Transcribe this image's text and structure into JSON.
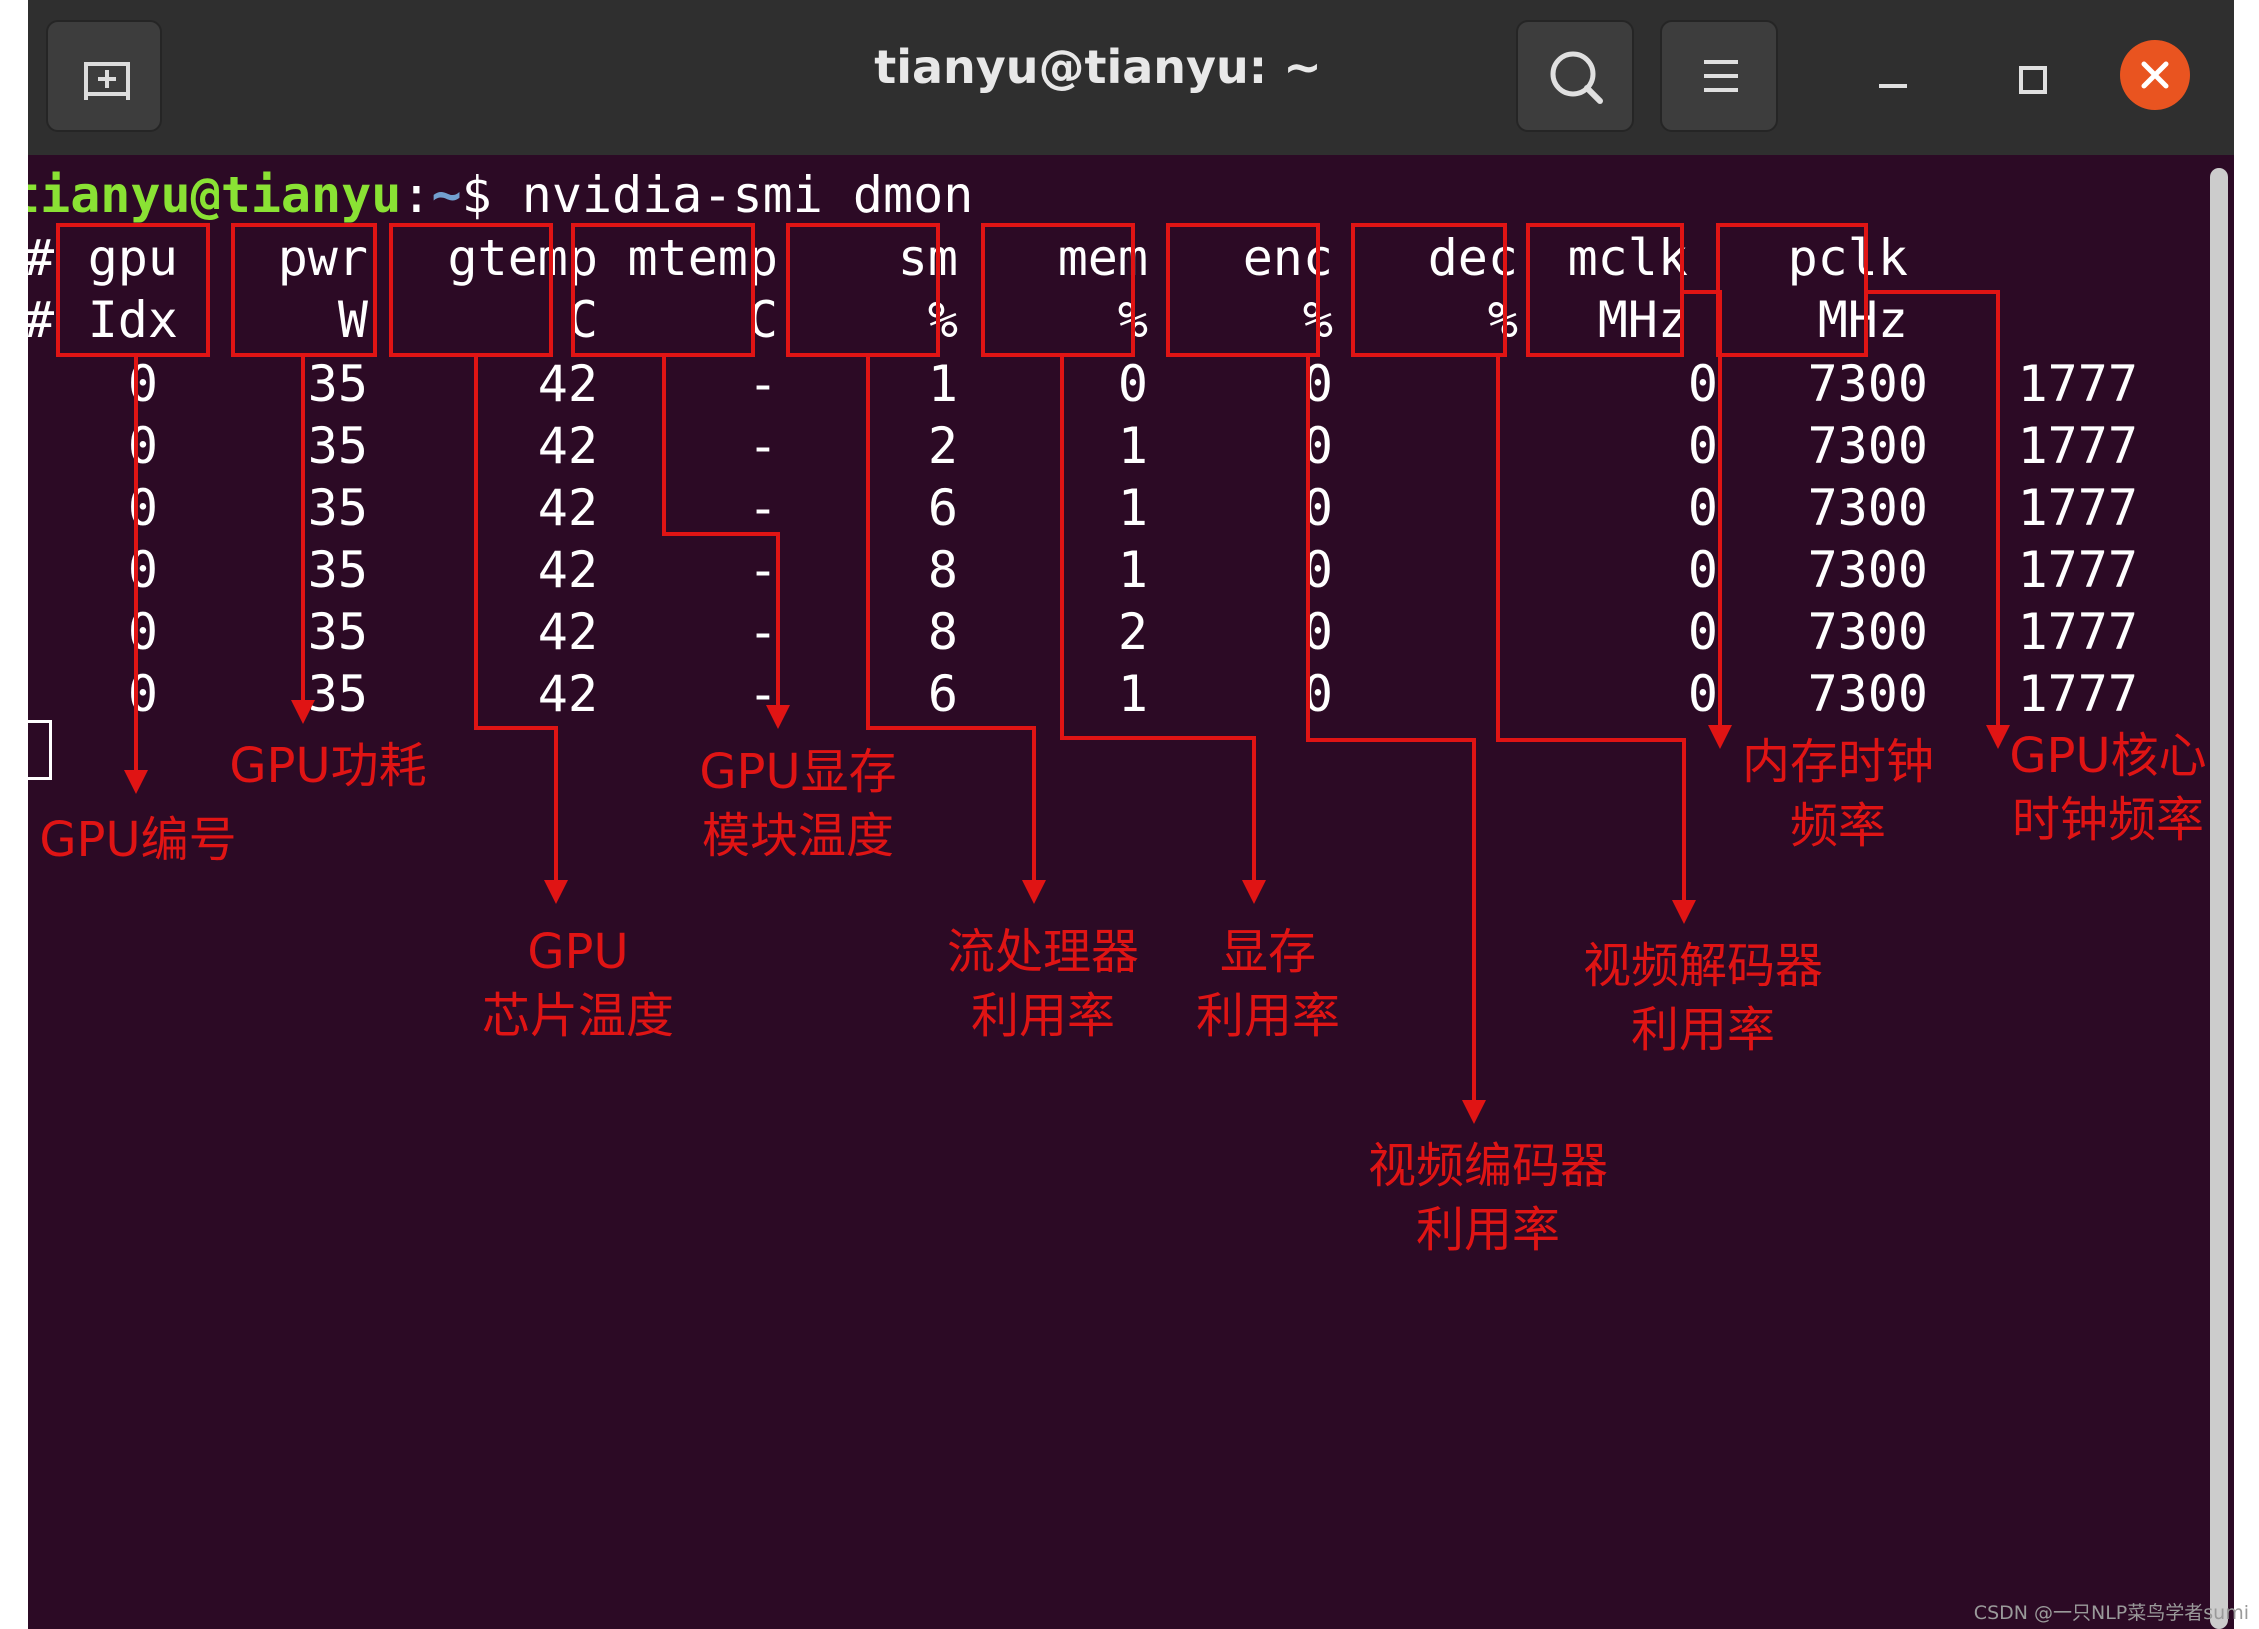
{
  "window": {
    "title": "tianyu@tianyu: ~"
  },
  "titlebar": {
    "new_tab_icon": "new-tab-icon",
    "search_icon": "search-icon",
    "menu_icon": "hamburger-menu-icon",
    "minimize_icon": "minimize-icon",
    "maximize_icon": "maximize-icon",
    "close_icon": "close-icon"
  },
  "terminal": {
    "prompt_user": "tianyu@tianyu",
    "prompt_sep": ":",
    "prompt_path": "~",
    "prompt_symbol": "$ ",
    "command": "nvidia-smi dmon",
    "hash": "#",
    "columns": [
      {
        "name": "gpu",
        "unit": "Idx"
      },
      {
        "name": "pwr",
        "unit": "W"
      },
      {
        "name": "gtemp",
        "unit": "C"
      },
      {
        "name": "mtemp",
        "unit": "C"
      },
      {
        "name": "sm",
        "unit": "%"
      },
      {
        "name": "mem",
        "unit": "%"
      },
      {
        "name": "enc",
        "unit": "%"
      },
      {
        "name": "dec",
        "unit": "%"
      },
      {
        "name": "mclk",
        "unit": "MHz"
      },
      {
        "name": "pclk",
        "unit": "MHz"
      }
    ],
    "rows": [
      [
        "0",
        "35",
        "42",
        "-",
        "1",
        "0",
        "0",
        "0",
        "7300",
        "1777"
      ],
      [
        "0",
        "35",
        "42",
        "-",
        "2",
        "1",
        "0",
        "0",
        "7300",
        "1777"
      ],
      [
        "0",
        "35",
        "42",
        "-",
        "6",
        "1",
        "0",
        "0",
        "7300",
        "1777"
      ],
      [
        "0",
        "35",
        "42",
        "-",
        "8",
        "1",
        "0",
        "0",
        "7300",
        "1777"
      ],
      [
        "0",
        "35",
        "42",
        "-",
        "8",
        "2",
        "0",
        "0",
        "7300",
        "1777"
      ],
      [
        "0",
        "35",
        "42",
        "-",
        "6",
        "1",
        "0",
        "0",
        "7300",
        "1777"
      ]
    ]
  },
  "annotations": {
    "gpu_idx": "GPU编号",
    "pwr": "GPU功耗",
    "gtemp_1": "GPU",
    "gtemp_2": "芯片温度",
    "mtemp_1": "GPU显存",
    "mtemp_2": "模块温度",
    "sm_1": "流处理器",
    "sm_2": "利用率",
    "mem_1": "显存",
    "mem_2": "利用率",
    "enc_1": "视频编码器",
    "enc_2": "利用率",
    "dec_1": "视频解码器",
    "dec_2": "利用率",
    "mclk_1": "内存时钟",
    "mclk_2": "频率",
    "pclk_1": "GPU核心",
    "pclk_2": "时钟频率",
    "color": "#e01414"
  },
  "watermark": "CSDN @一只NLP菜鸟学者sumi"
}
